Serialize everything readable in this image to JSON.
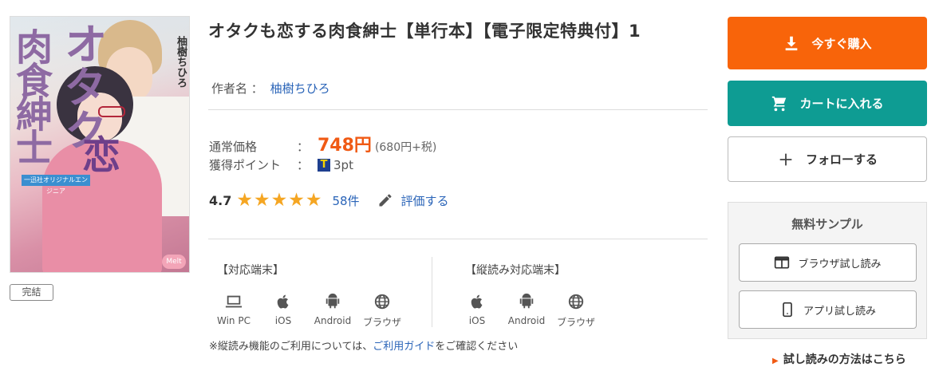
{
  "cover": {
    "title_vertical_1": "肉食紳士",
    "title_vertical_2": "オタク",
    "koi": "恋",
    "author_vertical": "柚樹ちひろ",
    "band": "一迅社オリジナルエンジニア",
    "logo": "Melt"
  },
  "badge": "完結",
  "title": "オタクも恋する肉食紳士【単行本】【電子限定特典付】1",
  "author": {
    "label": "作者名 ：",
    "name": "柚樹ちひろ"
  },
  "price": {
    "label": "通常価格",
    "sep": "：",
    "value": "748円",
    "tax": "(680円+税)"
  },
  "points": {
    "label": "獲得ポイント",
    "sep": "：",
    "icon": "T",
    "value": "3pt"
  },
  "rating": {
    "score": "4.7",
    "stars": "★★★★★",
    "count": "58件",
    "rate_label": "評価する"
  },
  "devices": {
    "supported_header": "【対応端末】",
    "supported": [
      {
        "icon": "laptop-icon",
        "label": "Win PC"
      },
      {
        "icon": "apple-icon",
        "label": "iOS"
      },
      {
        "icon": "android-icon",
        "label": "Android"
      },
      {
        "icon": "globe-icon",
        "label": "ブラウザ"
      }
    ],
    "vertical_header": "【縦読み対応端末】",
    "vertical": [
      {
        "icon": "apple-icon",
        "label": "iOS"
      },
      {
        "icon": "android-icon",
        "label": "Android"
      },
      {
        "icon": "globe-icon",
        "label": "ブラウザ"
      }
    ]
  },
  "note": {
    "prefix": "※縦読み機能のご利用については、",
    "link": "ご利用ガイド",
    "suffix": "をご確認ください"
  },
  "actions": {
    "buy": "今すぐ購入",
    "cart": "カートに入れる",
    "follow": "フォローする"
  },
  "sample": {
    "title": "無料サンプル",
    "browser": "ブラウザ試し読み",
    "app": "アプリ試し読み"
  },
  "howto": "試し読みの方法はこちら",
  "colors": {
    "buy": "#f8640a",
    "cart": "#0e9c93",
    "price": "#f05a14",
    "link": "#2a64b8",
    "star": "#f5a623"
  }
}
